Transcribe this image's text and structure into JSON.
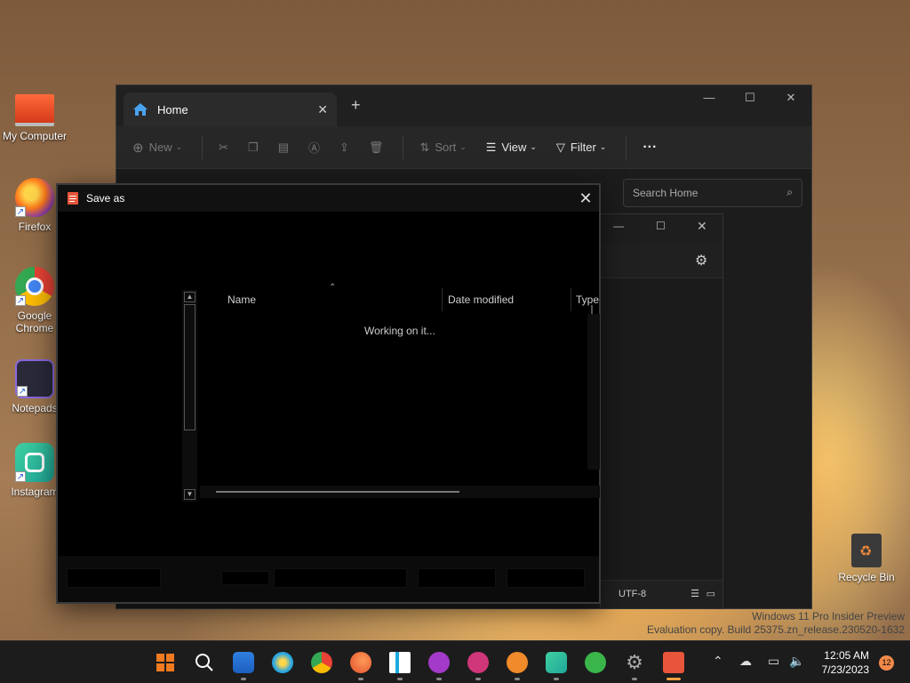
{
  "desktop": {
    "icons": [
      {
        "label": "My Computer"
      },
      {
        "label": "Firefox"
      },
      {
        "label": "Google Chrome"
      },
      {
        "label": "Notepads"
      },
      {
        "label": "Instagram"
      }
    ],
    "recycle_bin": "Recycle Bin"
  },
  "explorer": {
    "tab_label": "Home",
    "toolbar": {
      "new": "New",
      "sort": "Sort",
      "view": "View",
      "filter": "Filter",
      "more": "···"
    },
    "search_placeholder": "Search Home"
  },
  "notepad": {
    "encoding": "UTF-8"
  },
  "save_dialog": {
    "title": "Save as",
    "columns": [
      "Name",
      "Date modified",
      "Type"
    ],
    "status": "Working on it..."
  },
  "watermark": {
    "line1": "Windows 11 Pro Insider Preview",
    "line2": "Evaluation copy. Build 25375.zn_release.230520-1632"
  },
  "taskbar": {
    "apps": [
      "start",
      "search",
      "file-explorer",
      "firefox",
      "chrome",
      "edge",
      "notion",
      "whatsapp",
      "spotify",
      "lightbulb",
      "instagram",
      "messenger",
      "settings",
      "notepads"
    ],
    "time": "12:05 AM",
    "date": "7/23/2023",
    "notifications": "12"
  },
  "colors": {
    "accent": "#f0a040",
    "taskbar": "#1c1c1c"
  }
}
